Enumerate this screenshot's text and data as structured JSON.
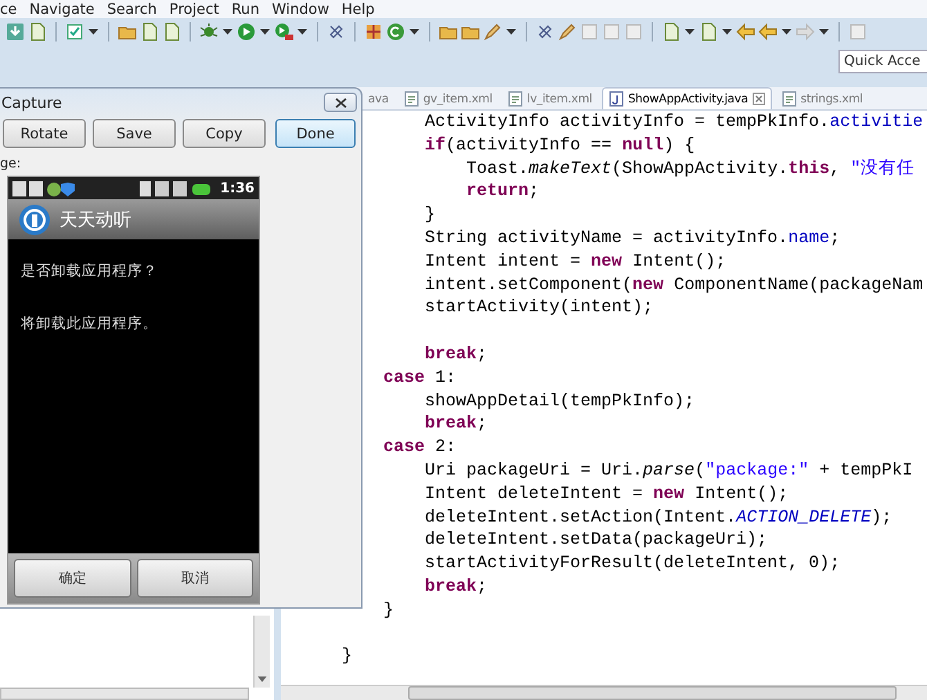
{
  "menu_bar": {
    "items": [
      "ce",
      "Navigate",
      "Search",
      "Project",
      "Run",
      "Window",
      "Help"
    ]
  },
  "quick_access": {
    "placeholder": "Quick Acce"
  },
  "editor": {
    "tabs": [
      {
        "label": "ava",
        "selected": false
      },
      {
        "label": "gv_item.xml",
        "kind": "xml",
        "selected": false
      },
      {
        "label": "lv_item.xml",
        "kind": "xml",
        "selected": false
      },
      {
        "label": "ShowAppActivity.java",
        "kind": "java",
        "selected": true
      },
      {
        "label": "strings.xml",
        "kind": "xml",
        "selected": false
      }
    ],
    "code_lines": [
      {
        "kind": "code",
        "tokens": [
          {
            "kind": "plain",
            "text": "        ActivityInfo activityInfo = tempPkInfo."
          },
          {
            "kind": "field",
            "text": "activitie"
          }
        ]
      },
      {
        "kind": "code",
        "tokens": [
          {
            "kind": "keyword",
            "text": "        if"
          },
          {
            "kind": "plain",
            "text": "(activityInfo == "
          },
          {
            "kind": "keyword",
            "text": "null"
          },
          {
            "kind": "plain",
            "text": ") {"
          }
        ]
      },
      {
        "kind": "code",
        "tokens": [
          {
            "kind": "plain",
            "text": "            Toast."
          },
          {
            "kind": "static",
            "text": "makeText"
          },
          {
            "kind": "plain",
            "text": "(ShowAppActivity."
          },
          {
            "kind": "keyword",
            "text": "this"
          },
          {
            "kind": "plain",
            "text": ", "
          },
          {
            "kind": "string",
            "text": "\"没有任"
          }
        ]
      },
      {
        "kind": "code",
        "tokens": [
          {
            "kind": "keyword",
            "text": "            return"
          },
          {
            "kind": "plain",
            "text": ";"
          }
        ]
      },
      {
        "kind": "code",
        "tokens": [
          {
            "kind": "plain",
            "text": "        }"
          }
        ]
      },
      {
        "kind": "code",
        "tokens": [
          {
            "kind": "plain",
            "text": "        String activityName = activityInfo."
          },
          {
            "kind": "field",
            "text": "name"
          },
          {
            "kind": "plain",
            "text": ";"
          }
        ]
      },
      {
        "kind": "code",
        "tokens": [
          {
            "kind": "plain",
            "text": "        Intent intent = "
          },
          {
            "kind": "keyword",
            "text": "new"
          },
          {
            "kind": "plain",
            "text": " Intent();"
          }
        ]
      },
      {
        "kind": "code",
        "tokens": [
          {
            "kind": "plain",
            "text": "        intent.setComponent("
          },
          {
            "kind": "keyword",
            "text": "new"
          },
          {
            "kind": "plain",
            "text": " ComponentName(packageNam"
          }
        ]
      },
      {
        "kind": "code",
        "tokens": [
          {
            "kind": "plain",
            "text": "        startActivity(intent);"
          }
        ]
      },
      {
        "kind": "blank"
      },
      {
        "kind": "code",
        "tokens": [
          {
            "kind": "keyword",
            "text": "        break"
          },
          {
            "kind": "plain",
            "text": ";"
          }
        ]
      },
      {
        "kind": "code",
        "tokens": [
          {
            "kind": "keyword",
            "text": "    case"
          },
          {
            "kind": "plain",
            "text": " 1:"
          }
        ]
      },
      {
        "kind": "code",
        "tokens": [
          {
            "kind": "plain",
            "text": "        showAppDetail(tempPkInfo);"
          }
        ]
      },
      {
        "kind": "code",
        "tokens": [
          {
            "kind": "keyword",
            "text": "        break"
          },
          {
            "kind": "plain",
            "text": ";"
          }
        ]
      },
      {
        "kind": "code",
        "tokens": [
          {
            "kind": "keyword",
            "text": "    case"
          },
          {
            "kind": "plain",
            "text": " 2:"
          }
        ]
      },
      {
        "kind": "code",
        "tokens": [
          {
            "kind": "plain",
            "text": "        Uri packageUri = Uri."
          },
          {
            "kind": "static",
            "text": "parse"
          },
          {
            "kind": "plain",
            "text": "("
          },
          {
            "kind": "string",
            "text": "\"package:\""
          },
          {
            "kind": "plain",
            "text": " + tempPkI"
          }
        ]
      },
      {
        "kind": "code",
        "tokens": [
          {
            "kind": "plain",
            "text": "        Intent deleteIntent = "
          },
          {
            "kind": "keyword",
            "text": "new"
          },
          {
            "kind": "plain",
            "text": " Intent();"
          }
        ]
      },
      {
        "kind": "code",
        "tokens": [
          {
            "kind": "plain",
            "text": "        deleteIntent.setAction(Intent."
          },
          {
            "kind": "constant",
            "text": "ACTION_DELETE"
          },
          {
            "kind": "plain",
            "text": ");"
          }
        ]
      },
      {
        "kind": "code",
        "tokens": [
          {
            "kind": "plain",
            "text": "        deleteIntent.setData(packageUri);"
          }
        ]
      },
      {
        "kind": "code",
        "tokens": [
          {
            "kind": "plain",
            "text": "        startActivityForResult(deleteIntent, 0);"
          }
        ]
      },
      {
        "kind": "code",
        "tokens": [
          {
            "kind": "keyword",
            "text": "        break"
          },
          {
            "kind": "plain",
            "text": ";"
          }
        ]
      },
      {
        "kind": "code",
        "tokens": [
          {
            "kind": "plain",
            "text": "    }"
          }
        ]
      },
      {
        "kind": "blank"
      },
      {
        "kind": "code",
        "tokens": [
          {
            "kind": "plain",
            "text": "}"
          }
        ]
      }
    ]
  },
  "capture_dialog": {
    "title": "Capture",
    "buttons": [
      {
        "label": "Rotate",
        "focused": false
      },
      {
        "label": "Save",
        "focused": false
      },
      {
        "label": "Copy",
        "focused": false
      },
      {
        "label": "Done",
        "focused": true
      }
    ],
    "image_label": "ge:",
    "phone_screen": {
      "time": "1:36",
      "app_title": "天天动听",
      "message_title": "是否卸载应用程序？",
      "message": "将卸载此应用程序。",
      "buttons": [
        "确定",
        "取消"
      ]
    }
  }
}
